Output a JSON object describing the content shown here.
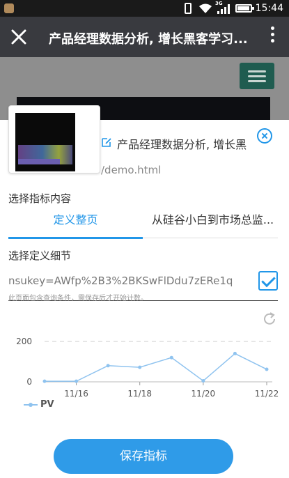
{
  "status_bar": {
    "network": "3G",
    "time": "15:44",
    "battery_level": 0.85
  },
  "title_bar": {
    "title": "产品经理数据分析, 增长黑客学习..."
  },
  "page_info": {
    "title": "产品经理数据分析, 增长黑",
    "url": "/demo.html"
  },
  "metric_section": {
    "label": "选择指标内容",
    "tabs": [
      {
        "label": "定义整页",
        "active": true
      },
      {
        "label": "从硅谷小白到市场总监...",
        "active": false
      }
    ]
  },
  "detail_section": {
    "label": "选择定义细节",
    "rule_value": "nsukey=AWfp%2B3%2BKSwFlDdu7zERe1q",
    "hint": "此页面包含查询条件，需保存后才开始计数。"
  },
  "chart_data": {
    "type": "line",
    "x": [
      "11/15",
      "11/16",
      "11/17",
      "11/18",
      "11/19",
      "11/20",
      "11/21",
      "11/22"
    ],
    "x_tick_labels": [
      "11/16",
      "11/18",
      "11/20",
      "11/22"
    ],
    "series": [
      {
        "name": "PV",
        "values": [
          3,
          3,
          80,
          72,
          120,
          5,
          140,
          62
        ]
      }
    ],
    "y_ticks": [
      0,
      200
    ],
    "ylim": [
      0,
      200
    ],
    "grid": true,
    "legend": "bottom-left",
    "color": "#8fc3ef"
  },
  "actions": {
    "save_label": "保存指标"
  },
  "colors": {
    "accent": "#2196e8",
    "button": "#2f9be8",
    "title_bar": "#393a3f"
  }
}
